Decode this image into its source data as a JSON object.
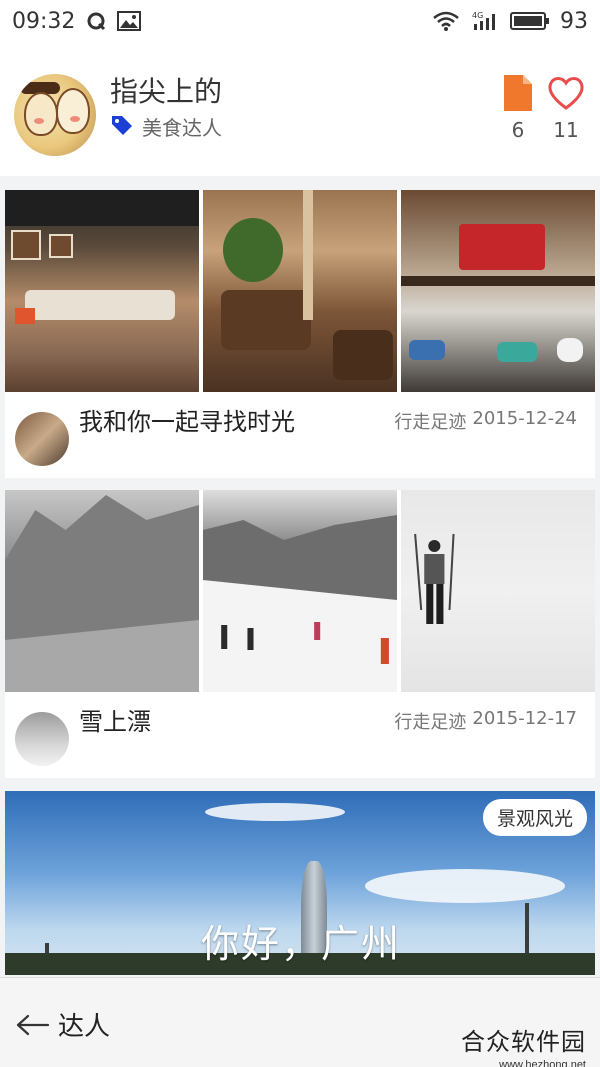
{
  "statusbar": {
    "time": "09:32",
    "battery": "93",
    "network": "4G"
  },
  "profile": {
    "name": "指尖上的",
    "tag": "美食达人",
    "posts_count": "6",
    "likes_count": "11"
  },
  "cards": [
    {
      "title": "我和你一起寻找时光",
      "category": "行走足迹",
      "date": "2015-12-24"
    },
    {
      "title": "雪上漂",
      "category": "行走足迹",
      "date": "2015-12-17"
    }
  ],
  "scenic": {
    "tag": "景观风光",
    "caption": "你好，广州"
  },
  "bottombar": {
    "back_label": "达人"
  },
  "watermark": {
    "title": "合众软件园",
    "url": "www.hezhong.net"
  },
  "colors": {
    "accent": "#f0782c",
    "heart": "#e84c4c",
    "tag_blue": "#1c3fd6"
  }
}
